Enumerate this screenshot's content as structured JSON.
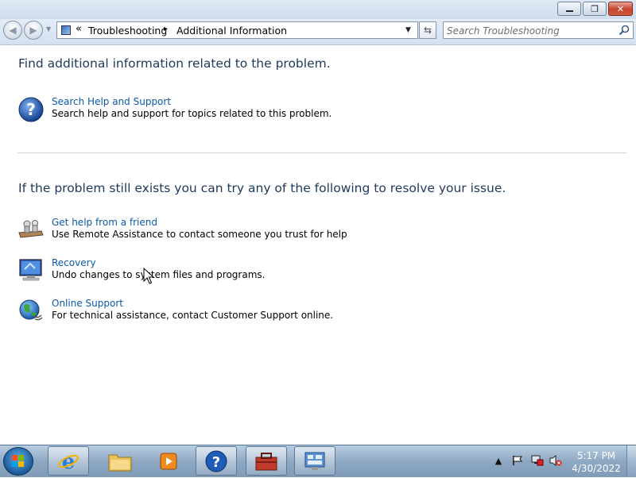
{
  "breadcrumb": {
    "chevron": "«",
    "items": [
      "Troubleshooting",
      "Additional Information"
    ],
    "separator": "▸"
  },
  "search": {
    "placeholder": "Search Troubleshooting"
  },
  "section1": {
    "heading": "Find additional information related to the problem.",
    "tasks": [
      {
        "title": "Search Help and Support",
        "desc": "Search help and support for topics related to this problem.",
        "icon": "help-icon"
      }
    ]
  },
  "section2": {
    "heading": "If the problem still exists you can try any of the following to resolve your issue.",
    "tasks": [
      {
        "title": "Get help from a friend",
        "desc": "Use Remote Assistance to contact someone you trust for help",
        "icon": "remote-assistance-icon"
      },
      {
        "title": "Recovery",
        "desc": "Undo changes to system files and programs.",
        "icon": "recovery-icon"
      },
      {
        "title": "Online Support",
        "desc": "For technical assistance, contact Customer Support online.",
        "icon": "online-support-icon"
      }
    ]
  },
  "taskbar": {
    "pinned": [
      "internet-explorer-icon",
      "windows-explorer-icon",
      "media-player-icon",
      "help-and-support-icon",
      "troubleshooting-icon",
      "control-panel-icon"
    ],
    "tray": [
      "show-hidden-icons",
      "action-center-flag-icon",
      "network-icon",
      "volume-muted-icon"
    ]
  },
  "clock": {
    "time": "5:17 PM",
    "date": "4/30/2022"
  },
  "colors": {
    "link": "#0b5aa8",
    "heading": "#1e395b"
  }
}
